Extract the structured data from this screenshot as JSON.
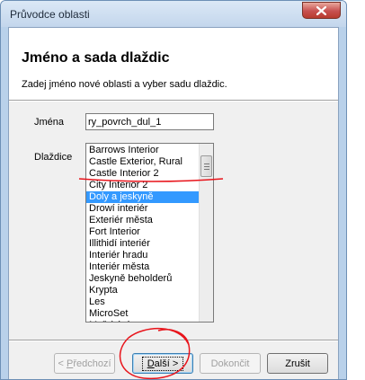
{
  "window": {
    "title": "Průvodce oblasti"
  },
  "header": {
    "title": "Jméno a sada dlaždic",
    "subtitle": "Zadej jméno nové oblasti a vyber sadu dlaždic."
  },
  "form": {
    "name_label": "Jména",
    "name_value": "ry_povrch_dul_1",
    "tiles_label": "Dlaždice",
    "tile_options": [
      "Barrows Interior",
      "Castle Exterior, Rural",
      "Castle Interior 2",
      "City Interior 2",
      "Doly a jeskyně",
      "Drowí interiér",
      "Exteriér města",
      "Fort Interior",
      "Illithidí interiér",
      "Interiér hradu",
      "Interiér města",
      "Jeskyně beholderů",
      "Krypta",
      "Les",
      "MicroSet",
      "Mořské dno"
    ],
    "selected_tile": "Doly a jeskyně"
  },
  "buttons": {
    "back": {
      "underline": "P",
      "rest": "ředchozí",
      "prefix": "< "
    },
    "next": {
      "underline": "D",
      "rest": "alší >"
    },
    "finish": {
      "label": "Dokončit"
    },
    "cancel": {
      "label": "Zrušit"
    }
  },
  "colors": {
    "selection": "#3399ff",
    "annotation_red": "#e8141b",
    "titlebar": "#c3d6ec",
    "close_button": "#c75050"
  },
  "icons": {
    "close": "close-icon"
  }
}
